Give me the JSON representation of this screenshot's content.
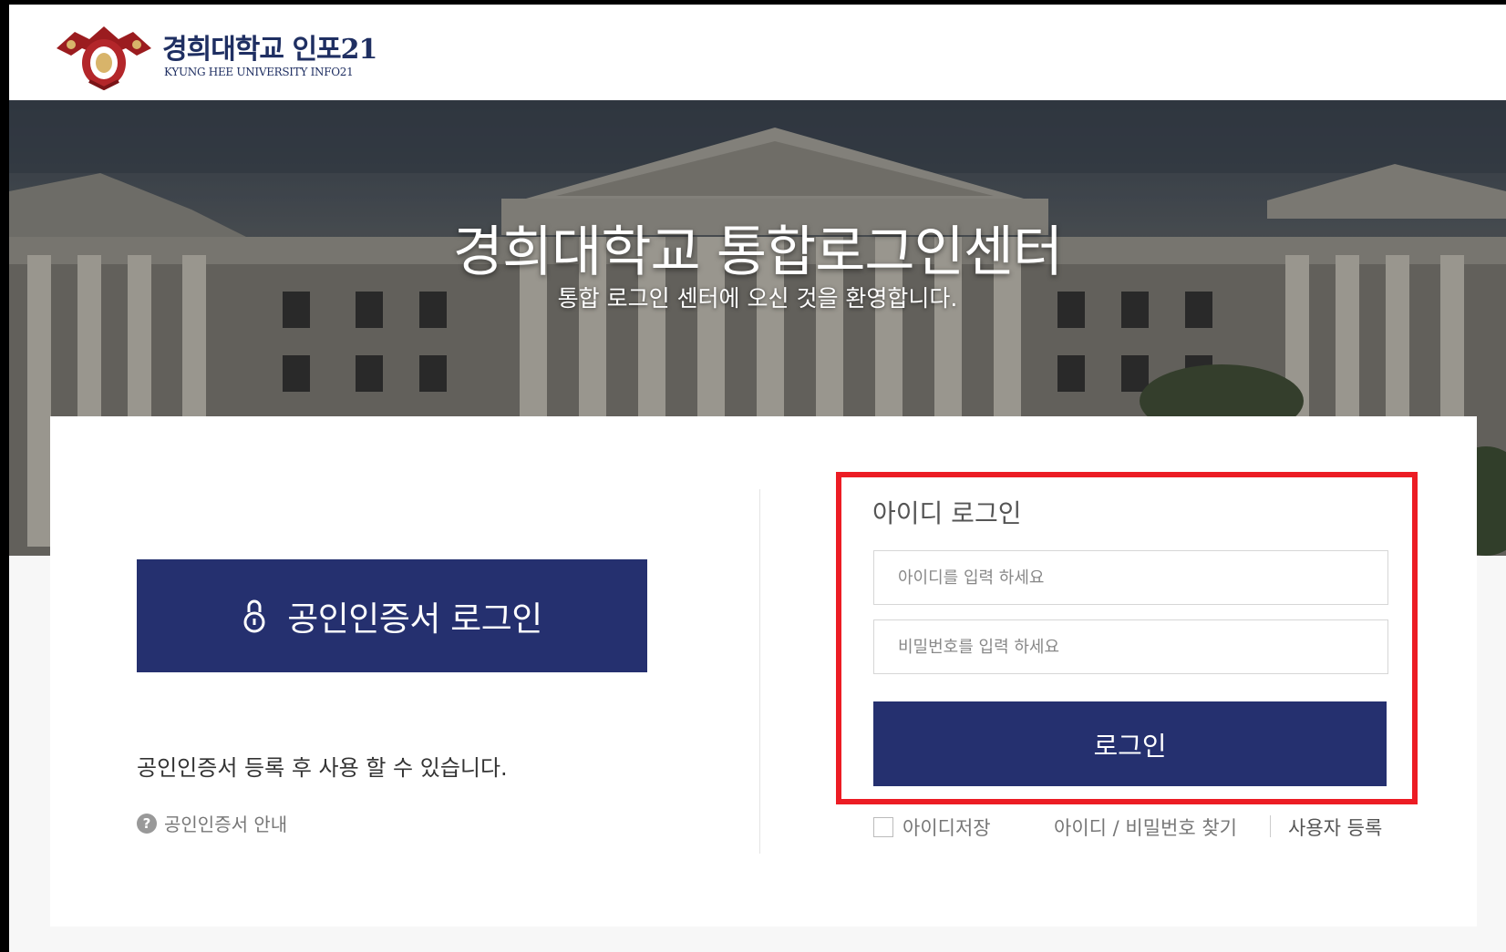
{
  "header": {
    "logo_title": "경희대학교 인포21",
    "logo_subtitle": "KYUNG HEE UNIVERSITY INFO21"
  },
  "hero": {
    "title": "경희대학교 통합로그인센터",
    "subtitle": "통합 로그인 센터에 오신 것을 환영합니다."
  },
  "cert_login": {
    "button_label": "공인인증서 로그인",
    "note": "공인인증서 등록 후 사용 할 수 있습니다.",
    "guide_label": "공인인증서 안내",
    "guide_icon_glyph": "?"
  },
  "id_login": {
    "title": "아이디 로그인",
    "id_placeholder": "아이디를 입력 하세요",
    "id_value": "",
    "pw_placeholder": "비밀번호를 입력 하세요",
    "pw_value": "",
    "button_label": "로그인",
    "save_id_label": "아이디저장",
    "save_id_checked": false,
    "find_label": "아이디 / 비밀번호 찾기",
    "register_label": "사용자 등록"
  },
  "colors": {
    "primary": "#25306f",
    "highlight": "#ec1c24",
    "logo_text": "#1f2f62"
  },
  "icons": {
    "cert_button_icon": "lock-icon",
    "guide_icon": "help-circle-icon",
    "logo": "university-emblem-icon"
  }
}
